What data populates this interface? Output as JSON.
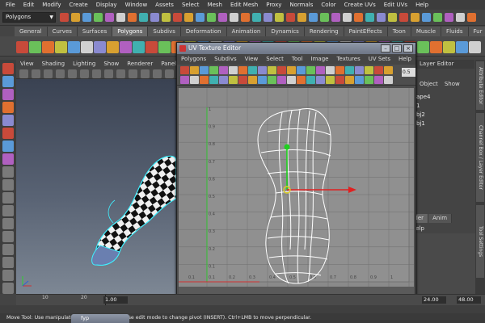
{
  "main_menu": [
    "File",
    "Edit",
    "Modify",
    "Create",
    "Display",
    "Window",
    "Assets",
    "Select",
    "Mesh",
    "Edit Mesh",
    "Proxy",
    "Normals",
    "Color",
    "Create UVs",
    "Edit UVs",
    "Help"
  ],
  "status_line": {
    "mode": "Polygons"
  },
  "shelf_tabs": [
    "General",
    "Curves",
    "Surfaces",
    "Polygons",
    "Subdivs",
    "Deformation",
    "Animation",
    "Dynamics",
    "Rendering",
    "PaintEffects",
    "Toon",
    "Muscle",
    "Fluids",
    "Fur"
  ],
  "shelf_active": "Polygons",
  "viewport_menu": [
    "View",
    "Shading",
    "Lighting",
    "Show",
    "Renderer",
    "Panels"
  ],
  "uv_editor": {
    "title": "UV Texture Editor",
    "menu": [
      "Polygons",
      "Subdivs",
      "View",
      "Select",
      "Tool",
      "Image",
      "Textures",
      "UV Sets",
      "Help"
    ],
    "zoom_value": "0.5",
    "grid_labels_y": [
      "1",
      "0.9",
      "0.8",
      "0.7",
      "0.6",
      "0.5",
      "0.4",
      "0.3",
      "0.2",
      "0.1"
    ],
    "grid_labels_x": [
      "0.1",
      "0.1",
      "0.2",
      "0.3",
      "0.4",
      "0.5",
      "0.6",
      "0.7",
      "0.8",
      "0.9",
      "1"
    ],
    "colors": {
      "axis_u": "#d03030",
      "axis_v": "#30c030",
      "manip_red": "#e02020",
      "manip_green": "#20d020",
      "manip_pivot": "#e0d020"
    }
  },
  "right_panel": {
    "layer_editor_label": "Layer Editor",
    "menu": [
      "Object",
      "Show"
    ],
    "items": [
      "ape4",
      "1",
      "bj2",
      "bj1"
    ],
    "layer_tabs": [
      "nder",
      "Anim"
    ],
    "layer_menu": [
      "Help"
    ],
    "vertical_tabs": [
      "Attribute Editor",
      "Channel Box / Layer Editor",
      "Tool Settings"
    ]
  },
  "timeline": {
    "ticks": [
      "10",
      "20"
    ],
    "current": "1.00",
    "start": "1.00",
    "end": "24.00",
    "max": "48.00"
  },
  "help_line": "Move Tool: Use manipulator to move object(s). Use edit mode to change pivot (INSERT).  Ctrl+LMB to move perpendicular.",
  "taskbar_item": "fyp"
}
